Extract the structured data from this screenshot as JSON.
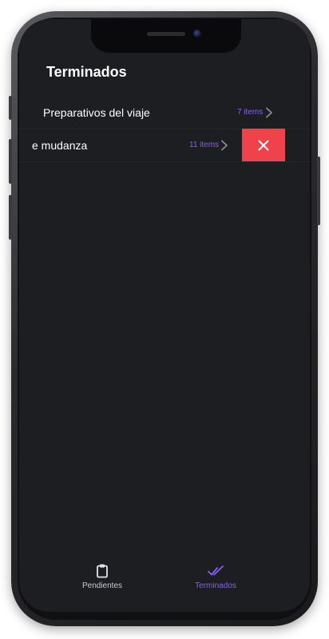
{
  "header": {
    "title": "Terminados"
  },
  "lists": [
    {
      "label": "Preparativos del viaje",
      "count": "7 items"
    },
    {
      "label": "e mudanza",
      "count": "11 items"
    }
  ],
  "swipe_action": {
    "icon": "close-icon",
    "color": "#f0424a"
  },
  "tabbar": {
    "tabs": [
      {
        "label": "Pendientes",
        "icon": "clipboard-icon",
        "active": false
      },
      {
        "label": "Terminados",
        "icon": "double-check-icon",
        "active": true
      }
    ]
  },
  "colors": {
    "background": "#1c1e22",
    "accent": "#8b5cf6",
    "text": "#ffffff",
    "inactive_tab": "#c9c9cf"
  }
}
